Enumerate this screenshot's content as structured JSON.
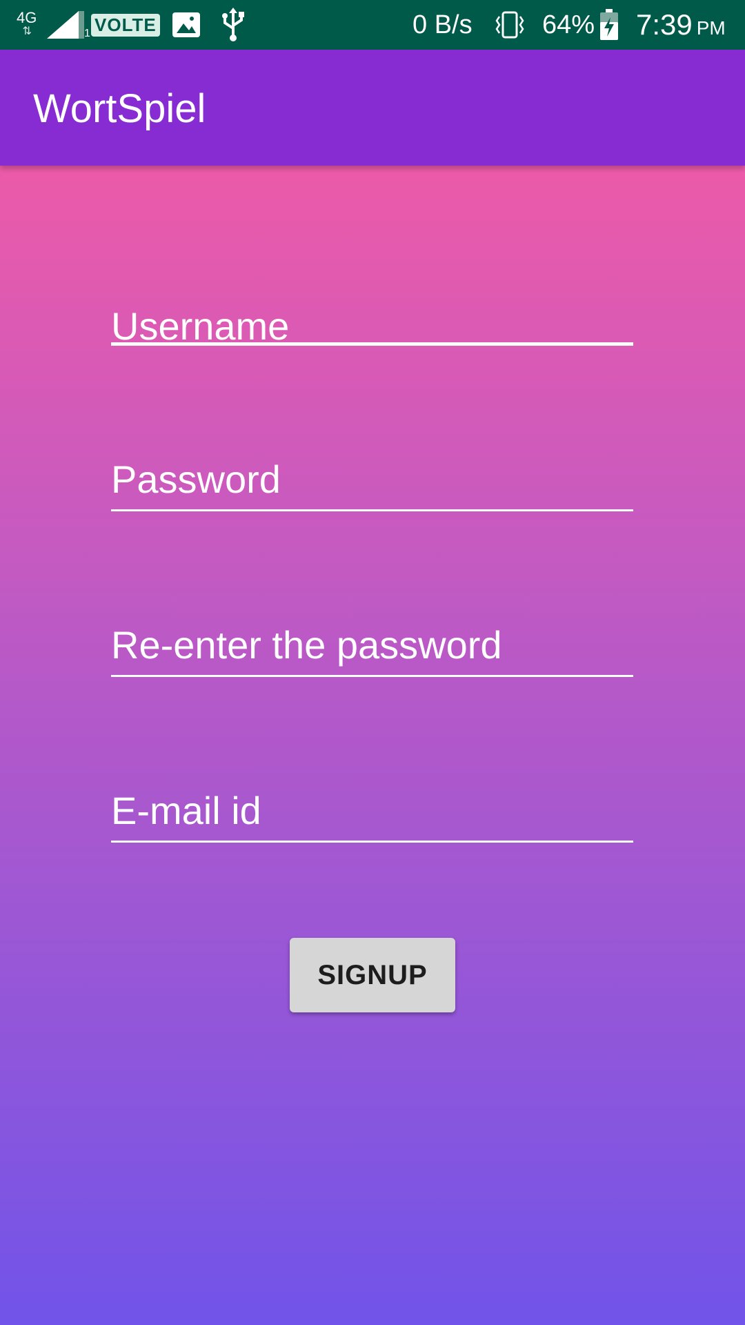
{
  "status_bar": {
    "network": "4G",
    "sim_slot": "1",
    "volte": "VOLTE",
    "data_speed": "0 B/s",
    "battery_percent": "64%",
    "time": "7:39",
    "ampm": "PM",
    "background_color": "#005a4a"
  },
  "app_bar": {
    "title": "WortSpiel",
    "color": "#872cd2"
  },
  "form": {
    "username_label": "Username",
    "password_label": "Password",
    "reenter_label": "Re-enter the password",
    "email_label": "E-mail id",
    "signup_label": "SIGNUP"
  },
  "background": {
    "gradient_top": "#fd5b9e",
    "gradient_bottom": "#7154e9"
  }
}
